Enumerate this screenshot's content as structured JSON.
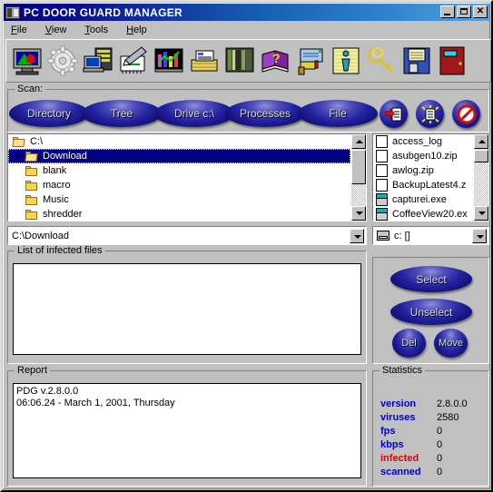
{
  "window": {
    "title": "PC DOOR GUARD MANAGER",
    "icon": "door-cabinet-icon",
    "minimize_label": "",
    "maximize_label": "",
    "close_label": "✕"
  },
  "menu": {
    "items": [
      {
        "label": "File",
        "accel": "F"
      },
      {
        "label": "View",
        "accel": "V"
      },
      {
        "label": "Tools",
        "accel": "T"
      },
      {
        "label": "Help",
        "accel": "H"
      }
    ]
  },
  "toolbar": {
    "buttons": [
      {
        "name": "monitor-display-icon"
      },
      {
        "name": "gear-settings-icon"
      },
      {
        "name": "computer-server-icon"
      },
      {
        "name": "notepad-pen-icon"
      },
      {
        "name": "bar-chart-icon"
      },
      {
        "name": "card-file-box-icon"
      },
      {
        "name": "bookshelf-icon"
      },
      {
        "name": "help-book-icon"
      },
      {
        "name": "mailbox-icon"
      },
      {
        "name": "info-icon"
      },
      {
        "name": "keys-icon"
      },
      {
        "name": "floppy-save-icon"
      },
      {
        "name": "red-door-icon"
      }
    ]
  },
  "scan": {
    "group_label": "Scan:",
    "buttons": [
      {
        "label": "Directory"
      },
      {
        "label": "Tree"
      },
      {
        "label": "Drive c:\\"
      },
      {
        "label": "Processes"
      },
      {
        "label": "File"
      }
    ],
    "round_buttons": [
      {
        "name": "scan-start-icon"
      },
      {
        "name": "scan-analyze-icon"
      },
      {
        "name": "scan-stop-icon"
      }
    ]
  },
  "tree": {
    "items": [
      {
        "label": "C:\\",
        "type": "open-folder",
        "indent": 0,
        "selected": false
      },
      {
        "label": "Download",
        "type": "open-folder",
        "indent": 1,
        "selected": true
      },
      {
        "label": "blank",
        "type": "folder",
        "indent": 1,
        "selected": false
      },
      {
        "label": "macro",
        "type": "folder",
        "indent": 1,
        "selected": false
      },
      {
        "label": "Music",
        "type": "folder",
        "indent": 1,
        "selected": false
      },
      {
        "label": "shredder",
        "type": "folder",
        "indent": 1,
        "selected": false
      }
    ]
  },
  "files": {
    "items": [
      {
        "label": "access_log",
        "type": "file"
      },
      {
        "label": "asubgen10.zip",
        "type": "file"
      },
      {
        "label": "awlog.zip",
        "type": "file"
      },
      {
        "label": "BackupLatest4.z",
        "type": "file"
      },
      {
        "label": "capturei.exe",
        "type": "exe"
      },
      {
        "label": "CoffeeView20.ex",
        "type": "exe"
      }
    ]
  },
  "path_combo": {
    "value": "C:\\Download"
  },
  "drive_combo": {
    "value": "c: []",
    "icon": "drive-icon"
  },
  "infected": {
    "group_label": "List of infected files",
    "items": []
  },
  "actions": {
    "select_label": "Select",
    "unselect_label": "Unselect",
    "del_label": "Del",
    "move_label": "Move"
  },
  "report": {
    "group_label": "Report",
    "lines": [
      "PDG v.2.8.0.0",
      "06:06.24 - March 1, 2001, Thursday"
    ]
  },
  "statistics": {
    "group_label": "Statistics",
    "rows": [
      {
        "label": "version",
        "value": "2.8.0.0",
        "accent": "#0000c8"
      },
      {
        "label": "viruses",
        "value": "2580",
        "accent": "#0000c8"
      },
      {
        "label": "fps",
        "value": "0",
        "accent": "#0000c8"
      },
      {
        "label": "kbps",
        "value": "0",
        "accent": "#0000c8"
      },
      {
        "label": "infected",
        "value": "0",
        "accent": "#e00000"
      },
      {
        "label": "scanned",
        "value": "0",
        "accent": "#0000c8"
      }
    ]
  },
  "colors": {
    "face": "#c0c0c0",
    "title_start": "#00007e",
    "title_end": "#5aa3e0",
    "selection": "#000080",
    "accent_blue": "#0000c8",
    "accent_red": "#e00000"
  }
}
